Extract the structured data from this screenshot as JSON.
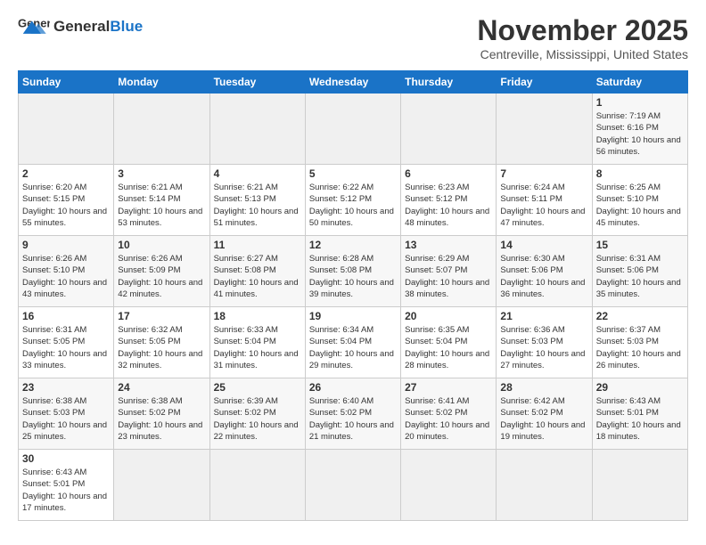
{
  "header": {
    "logo_general": "General",
    "logo_blue": "Blue",
    "month": "November 2025",
    "location": "Centreville, Mississippi, United States"
  },
  "days_of_week": [
    "Sunday",
    "Monday",
    "Tuesday",
    "Wednesday",
    "Thursday",
    "Friday",
    "Saturday"
  ],
  "weeks": [
    [
      null,
      null,
      null,
      null,
      null,
      null,
      {
        "day": 1,
        "sunrise": "Sunrise: 7:19 AM",
        "sunset": "Sunset: 6:16 PM",
        "daylight": "Daylight: 10 hours and 56 minutes."
      }
    ],
    [
      {
        "day": 2,
        "sunrise": "Sunrise: 6:20 AM",
        "sunset": "Sunset: 5:15 PM",
        "daylight": "Daylight: 10 hours and 55 minutes."
      },
      {
        "day": 3,
        "sunrise": "Sunrise: 6:21 AM",
        "sunset": "Sunset: 5:14 PM",
        "daylight": "Daylight: 10 hours and 53 minutes."
      },
      {
        "day": 4,
        "sunrise": "Sunrise: 6:21 AM",
        "sunset": "Sunset: 5:13 PM",
        "daylight": "Daylight: 10 hours and 51 minutes."
      },
      {
        "day": 5,
        "sunrise": "Sunrise: 6:22 AM",
        "sunset": "Sunset: 5:12 PM",
        "daylight": "Daylight: 10 hours and 50 minutes."
      },
      {
        "day": 6,
        "sunrise": "Sunrise: 6:23 AM",
        "sunset": "Sunset: 5:12 PM",
        "daylight": "Daylight: 10 hours and 48 minutes."
      },
      {
        "day": 7,
        "sunrise": "Sunrise: 6:24 AM",
        "sunset": "Sunset: 5:11 PM",
        "daylight": "Daylight: 10 hours and 47 minutes."
      },
      {
        "day": 8,
        "sunrise": "Sunrise: 6:25 AM",
        "sunset": "Sunset: 5:10 PM",
        "daylight": "Daylight: 10 hours and 45 minutes."
      }
    ],
    [
      {
        "day": 9,
        "sunrise": "Sunrise: 6:26 AM",
        "sunset": "Sunset: 5:10 PM",
        "daylight": "Daylight: 10 hours and 43 minutes."
      },
      {
        "day": 10,
        "sunrise": "Sunrise: 6:26 AM",
        "sunset": "Sunset: 5:09 PM",
        "daylight": "Daylight: 10 hours and 42 minutes."
      },
      {
        "day": 11,
        "sunrise": "Sunrise: 6:27 AM",
        "sunset": "Sunset: 5:08 PM",
        "daylight": "Daylight: 10 hours and 41 minutes."
      },
      {
        "day": 12,
        "sunrise": "Sunrise: 6:28 AM",
        "sunset": "Sunset: 5:08 PM",
        "daylight": "Daylight: 10 hours and 39 minutes."
      },
      {
        "day": 13,
        "sunrise": "Sunrise: 6:29 AM",
        "sunset": "Sunset: 5:07 PM",
        "daylight": "Daylight: 10 hours and 38 minutes."
      },
      {
        "day": 14,
        "sunrise": "Sunrise: 6:30 AM",
        "sunset": "Sunset: 5:06 PM",
        "daylight": "Daylight: 10 hours and 36 minutes."
      },
      {
        "day": 15,
        "sunrise": "Sunrise: 6:31 AM",
        "sunset": "Sunset: 5:06 PM",
        "daylight": "Daylight: 10 hours and 35 minutes."
      }
    ],
    [
      {
        "day": 16,
        "sunrise": "Sunrise: 6:31 AM",
        "sunset": "Sunset: 5:05 PM",
        "daylight": "Daylight: 10 hours and 33 minutes."
      },
      {
        "day": 17,
        "sunrise": "Sunrise: 6:32 AM",
        "sunset": "Sunset: 5:05 PM",
        "daylight": "Daylight: 10 hours and 32 minutes."
      },
      {
        "day": 18,
        "sunrise": "Sunrise: 6:33 AM",
        "sunset": "Sunset: 5:04 PM",
        "daylight": "Daylight: 10 hours and 31 minutes."
      },
      {
        "day": 19,
        "sunrise": "Sunrise: 6:34 AM",
        "sunset": "Sunset: 5:04 PM",
        "daylight": "Daylight: 10 hours and 29 minutes."
      },
      {
        "day": 20,
        "sunrise": "Sunrise: 6:35 AM",
        "sunset": "Sunset: 5:04 PM",
        "daylight": "Daylight: 10 hours and 28 minutes."
      },
      {
        "day": 21,
        "sunrise": "Sunrise: 6:36 AM",
        "sunset": "Sunset: 5:03 PM",
        "daylight": "Daylight: 10 hours and 27 minutes."
      },
      {
        "day": 22,
        "sunrise": "Sunrise: 6:37 AM",
        "sunset": "Sunset: 5:03 PM",
        "daylight": "Daylight: 10 hours and 26 minutes."
      }
    ],
    [
      {
        "day": 23,
        "sunrise": "Sunrise: 6:38 AM",
        "sunset": "Sunset: 5:03 PM",
        "daylight": "Daylight: 10 hours and 25 minutes."
      },
      {
        "day": 24,
        "sunrise": "Sunrise: 6:38 AM",
        "sunset": "Sunset: 5:02 PM",
        "daylight": "Daylight: 10 hours and 23 minutes."
      },
      {
        "day": 25,
        "sunrise": "Sunrise: 6:39 AM",
        "sunset": "Sunset: 5:02 PM",
        "daylight": "Daylight: 10 hours and 22 minutes."
      },
      {
        "day": 26,
        "sunrise": "Sunrise: 6:40 AM",
        "sunset": "Sunset: 5:02 PM",
        "daylight": "Daylight: 10 hours and 21 minutes."
      },
      {
        "day": 27,
        "sunrise": "Sunrise: 6:41 AM",
        "sunset": "Sunset: 5:02 PM",
        "daylight": "Daylight: 10 hours and 20 minutes."
      },
      {
        "day": 28,
        "sunrise": "Sunrise: 6:42 AM",
        "sunset": "Sunset: 5:02 PM",
        "daylight": "Daylight: 10 hours and 19 minutes."
      },
      {
        "day": 29,
        "sunrise": "Sunrise: 6:43 AM",
        "sunset": "Sunset: 5:01 PM",
        "daylight": "Daylight: 10 hours and 18 minutes."
      }
    ],
    [
      {
        "day": 30,
        "sunrise": "Sunrise: 6:43 AM",
        "sunset": "Sunset: 5:01 PM",
        "daylight": "Daylight: 10 hours and 17 minutes."
      },
      null,
      null,
      null,
      null,
      null,
      null
    ]
  ]
}
